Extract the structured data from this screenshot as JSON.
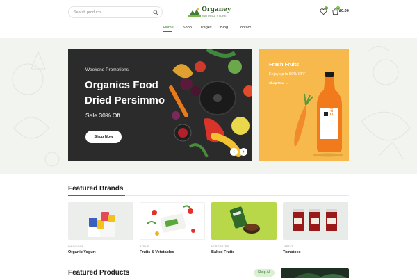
{
  "header": {
    "search_placeholder": "Search products...",
    "logo_name": "Organey",
    "logo_tag": "NATURAL STORE",
    "wishlist_count": "0",
    "cart_count": "0",
    "cart_total": "£0.00"
  },
  "nav": {
    "items": [
      {
        "label": "Home",
        "has_dropdown": true,
        "active": true
      },
      {
        "label": "Shop",
        "has_dropdown": true
      },
      {
        "label": "Pages",
        "has_dropdown": true
      },
      {
        "label": "Blog",
        "has_dropdown": true
      },
      {
        "label": "Contact",
        "has_dropdown": false
      }
    ]
  },
  "hero": {
    "eyebrow": "Weekend Promotions",
    "title_line1": "Organics Food",
    "title_line2": "Dried Persimmo",
    "sale": "Sale 30% Off",
    "button": "Shop Now",
    "prev_arrow": "‹",
    "next_arrow": "›"
  },
  "side_banner": {
    "title": "Fresh Fruits",
    "subtitle": "Enjoy up to 50% OFF",
    "link": "Shop Now →",
    "bottle_label": "CARROT"
  },
  "featured_brands": {
    "title": "Featured Brands",
    "items": [
      {
        "category": "DAVICIOUS",
        "name": "Organic Yogurt"
      },
      {
        "category": "ATRUE",
        "name": "Fruits & Vetetables"
      },
      {
        "category": "NOBGRATES",
        "name": "Baked Fruits"
      },
      {
        "category": "JARDIT",
        "name": "Tomatoes"
      }
    ]
  },
  "featured_products": {
    "title": "Featured Products",
    "view_all": "Shop All"
  },
  "colors": {
    "brand_green": "#3a7f2a",
    "hero_dark": "#2b2b2b",
    "side_banner": "#f7b94c",
    "band_bg": "#f2f4ef"
  },
  "icons": [
    "search-icon",
    "wishlist-icon",
    "cart-icon",
    "chevron-down-icon",
    "arrow-left-icon",
    "arrow-right-icon"
  ]
}
